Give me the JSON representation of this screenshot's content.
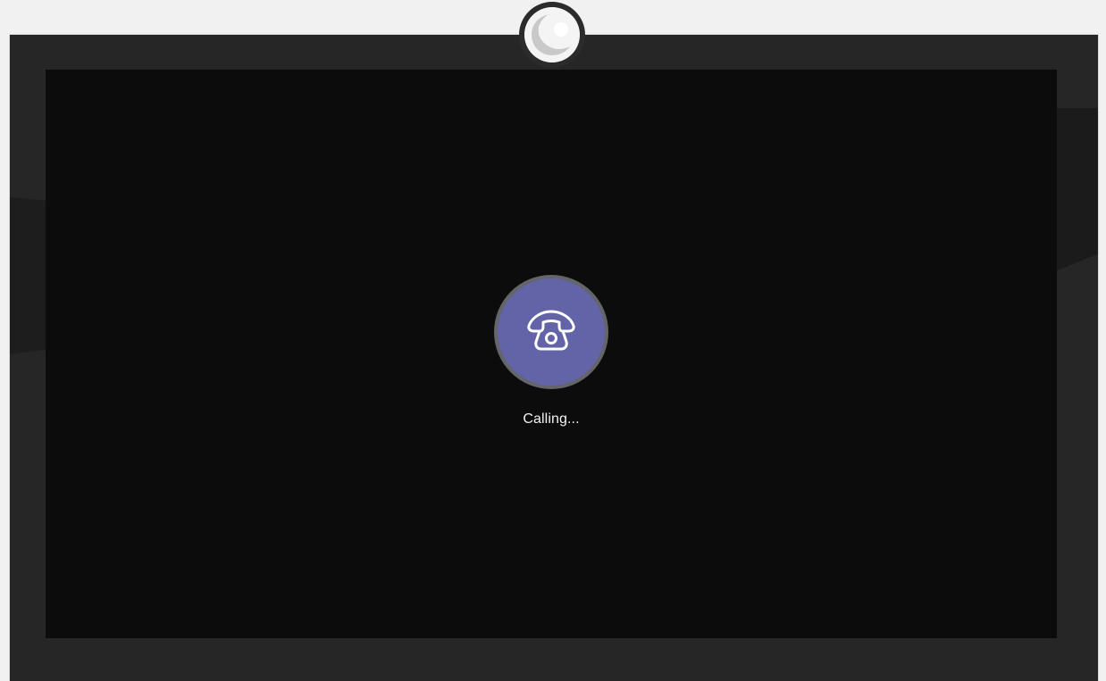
{
  "call": {
    "status": "Calling...",
    "icon": "phone-icon"
  },
  "device": {
    "camera_icon": "camera-lens-icon"
  },
  "colors": {
    "page_background": "#f1f1f1",
    "frame": "#262626",
    "screen": "#0c0c0d",
    "avatar_ring": "#636569",
    "accent": "#6264a7",
    "text": "#f2f2f2"
  }
}
